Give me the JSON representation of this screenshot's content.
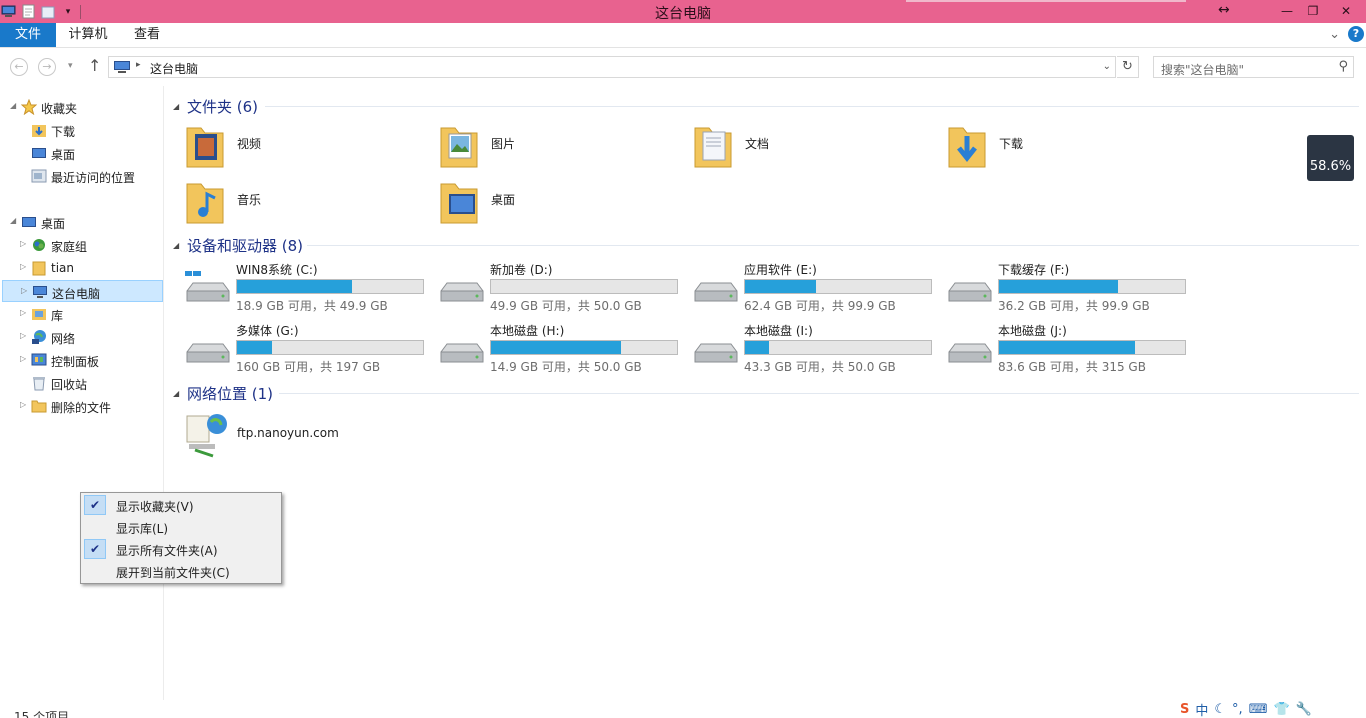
{
  "window": {
    "title": "这台电脑",
    "size_glyph": "↔",
    "minimize": "—",
    "restore": "❐",
    "close": "✕"
  },
  "ribbon": {
    "tabs": [
      "文件",
      "计算机",
      "查看"
    ],
    "help": "?",
    "collapse": "⌄"
  },
  "nav": {
    "back": "←",
    "forward": "→",
    "up": "↑",
    "history": "▾"
  },
  "address": {
    "crumb": "这台电脑",
    "separator": "▸",
    "dropdown": "⌄",
    "refresh": "↻"
  },
  "search": {
    "placeholder": "搜索\"这台电脑\"",
    "icon": "⚲"
  },
  "sidebar": {
    "favorites": {
      "label": "收藏夹",
      "items": [
        "下载",
        "桌面",
        "最近访问的位置"
      ]
    },
    "desktop": "桌面",
    "tree": [
      {
        "label": "家庭组",
        "icon": "homegroup-icon"
      },
      {
        "label": "tian",
        "icon": "user-folder-icon"
      },
      {
        "label": "这台电脑",
        "icon": "computer-icon",
        "selected": true
      },
      {
        "label": "库",
        "icon": "library-icon"
      },
      {
        "label": "网络",
        "icon": "network-icon"
      },
      {
        "label": "控制面板",
        "icon": "control-panel-icon"
      },
      {
        "label": "回收站",
        "icon": "recycle-bin-icon"
      },
      {
        "label": "删除的文件",
        "icon": "folder-icon"
      }
    ]
  },
  "sections": {
    "folders": {
      "title": "文件夹 (6)",
      "items": [
        "视频",
        "图片",
        "文档",
        "下载",
        "音乐",
        "桌面"
      ]
    },
    "drives": {
      "title": "设备和驱动器 (8)",
      "items": [
        {
          "name": "WIN8系统 (C:)",
          "free": "18.9 GB 可用，共 49.9 GB",
          "used_fraction": 0.62
        },
        {
          "name": "新加卷 (D:)",
          "free": "49.9 GB 可用，共 50.0 GB",
          "used_fraction": 0.0
        },
        {
          "name": "应用软件 (E:)",
          "free": "62.4 GB 可用，共 99.9 GB",
          "used_fraction": 0.38
        },
        {
          "name": "下载缓存 (F:)",
          "free": "36.2 GB 可用，共 99.9 GB",
          "used_fraction": 0.64
        },
        {
          "name": "多媒体 (G:)",
          "free": "160 GB 可用，共 197 GB",
          "used_fraction": 0.19
        },
        {
          "name": "本地磁盘 (H:)",
          "free": "14.9 GB 可用，共 50.0 GB",
          "used_fraction": 0.7
        },
        {
          "name": "本地磁盘 (I:)",
          "free": "43.3 GB 可用，共 50.0 GB",
          "used_fraction": 0.13
        },
        {
          "name": "本地磁盘 (J:)",
          "free": "83.6 GB 可用，共 315 GB",
          "used_fraction": 0.73
        }
      ]
    },
    "network": {
      "title": "网络位置 (1)",
      "items": [
        "ftp.nanoyun.com"
      ]
    }
  },
  "badge": "58.6%",
  "context_menu": [
    {
      "label": "显示收藏夹(V)",
      "checked": true
    },
    {
      "label": "显示库(L)",
      "checked": false
    },
    {
      "label": "显示所有文件夹(A)",
      "checked": true
    },
    {
      "label": "展开到当前文件夹(C)",
      "checked": false
    }
  ],
  "status": "15 个项目",
  "tray": [
    "中",
    "☾",
    "°,",
    "⌨",
    "👕",
    "🔧"
  ]
}
